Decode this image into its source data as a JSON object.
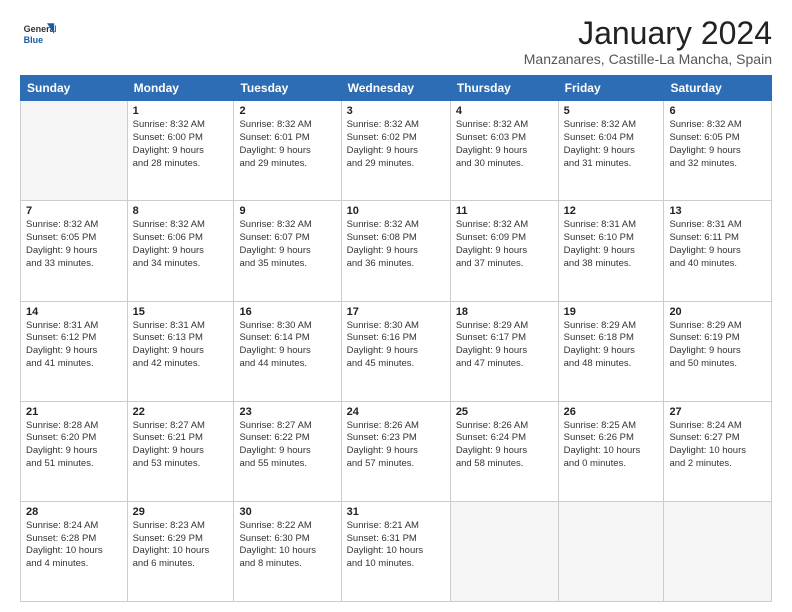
{
  "logo": {
    "line1": "General",
    "line2": "Blue"
  },
  "header": {
    "month": "January 2024",
    "location": "Manzanares, Castille-La Mancha, Spain"
  },
  "weekdays": [
    "Sunday",
    "Monday",
    "Tuesday",
    "Wednesday",
    "Thursday",
    "Friday",
    "Saturday"
  ],
  "weeks": [
    [
      {
        "day": "",
        "info": ""
      },
      {
        "day": "1",
        "info": "Sunrise: 8:32 AM\nSunset: 6:00 PM\nDaylight: 9 hours\nand 28 minutes."
      },
      {
        "day": "2",
        "info": "Sunrise: 8:32 AM\nSunset: 6:01 PM\nDaylight: 9 hours\nand 29 minutes."
      },
      {
        "day": "3",
        "info": "Sunrise: 8:32 AM\nSunset: 6:02 PM\nDaylight: 9 hours\nand 29 minutes."
      },
      {
        "day": "4",
        "info": "Sunrise: 8:32 AM\nSunset: 6:03 PM\nDaylight: 9 hours\nand 30 minutes."
      },
      {
        "day": "5",
        "info": "Sunrise: 8:32 AM\nSunset: 6:04 PM\nDaylight: 9 hours\nand 31 minutes."
      },
      {
        "day": "6",
        "info": "Sunrise: 8:32 AM\nSunset: 6:05 PM\nDaylight: 9 hours\nand 32 minutes."
      }
    ],
    [
      {
        "day": "7",
        "info": "Sunrise: 8:32 AM\nSunset: 6:05 PM\nDaylight: 9 hours\nand 33 minutes."
      },
      {
        "day": "8",
        "info": "Sunrise: 8:32 AM\nSunset: 6:06 PM\nDaylight: 9 hours\nand 34 minutes."
      },
      {
        "day": "9",
        "info": "Sunrise: 8:32 AM\nSunset: 6:07 PM\nDaylight: 9 hours\nand 35 minutes."
      },
      {
        "day": "10",
        "info": "Sunrise: 8:32 AM\nSunset: 6:08 PM\nDaylight: 9 hours\nand 36 minutes."
      },
      {
        "day": "11",
        "info": "Sunrise: 8:32 AM\nSunset: 6:09 PM\nDaylight: 9 hours\nand 37 minutes."
      },
      {
        "day": "12",
        "info": "Sunrise: 8:31 AM\nSunset: 6:10 PM\nDaylight: 9 hours\nand 38 minutes."
      },
      {
        "day": "13",
        "info": "Sunrise: 8:31 AM\nSunset: 6:11 PM\nDaylight: 9 hours\nand 40 minutes."
      }
    ],
    [
      {
        "day": "14",
        "info": "Sunrise: 8:31 AM\nSunset: 6:12 PM\nDaylight: 9 hours\nand 41 minutes."
      },
      {
        "day": "15",
        "info": "Sunrise: 8:31 AM\nSunset: 6:13 PM\nDaylight: 9 hours\nand 42 minutes."
      },
      {
        "day": "16",
        "info": "Sunrise: 8:30 AM\nSunset: 6:14 PM\nDaylight: 9 hours\nand 44 minutes."
      },
      {
        "day": "17",
        "info": "Sunrise: 8:30 AM\nSunset: 6:16 PM\nDaylight: 9 hours\nand 45 minutes."
      },
      {
        "day": "18",
        "info": "Sunrise: 8:29 AM\nSunset: 6:17 PM\nDaylight: 9 hours\nand 47 minutes."
      },
      {
        "day": "19",
        "info": "Sunrise: 8:29 AM\nSunset: 6:18 PM\nDaylight: 9 hours\nand 48 minutes."
      },
      {
        "day": "20",
        "info": "Sunrise: 8:29 AM\nSunset: 6:19 PM\nDaylight: 9 hours\nand 50 minutes."
      }
    ],
    [
      {
        "day": "21",
        "info": "Sunrise: 8:28 AM\nSunset: 6:20 PM\nDaylight: 9 hours\nand 51 minutes."
      },
      {
        "day": "22",
        "info": "Sunrise: 8:27 AM\nSunset: 6:21 PM\nDaylight: 9 hours\nand 53 minutes."
      },
      {
        "day": "23",
        "info": "Sunrise: 8:27 AM\nSunset: 6:22 PM\nDaylight: 9 hours\nand 55 minutes."
      },
      {
        "day": "24",
        "info": "Sunrise: 8:26 AM\nSunset: 6:23 PM\nDaylight: 9 hours\nand 57 minutes."
      },
      {
        "day": "25",
        "info": "Sunrise: 8:26 AM\nSunset: 6:24 PM\nDaylight: 9 hours\nand 58 minutes."
      },
      {
        "day": "26",
        "info": "Sunrise: 8:25 AM\nSunset: 6:26 PM\nDaylight: 10 hours\nand 0 minutes."
      },
      {
        "day": "27",
        "info": "Sunrise: 8:24 AM\nSunset: 6:27 PM\nDaylight: 10 hours\nand 2 minutes."
      }
    ],
    [
      {
        "day": "28",
        "info": "Sunrise: 8:24 AM\nSunset: 6:28 PM\nDaylight: 10 hours\nand 4 minutes."
      },
      {
        "day": "29",
        "info": "Sunrise: 8:23 AM\nSunset: 6:29 PM\nDaylight: 10 hours\nand 6 minutes."
      },
      {
        "day": "30",
        "info": "Sunrise: 8:22 AM\nSunset: 6:30 PM\nDaylight: 10 hours\nand 8 minutes."
      },
      {
        "day": "31",
        "info": "Sunrise: 8:21 AM\nSunset: 6:31 PM\nDaylight: 10 hours\nand 10 minutes."
      },
      {
        "day": "",
        "info": ""
      },
      {
        "day": "",
        "info": ""
      },
      {
        "day": "",
        "info": ""
      }
    ]
  ]
}
